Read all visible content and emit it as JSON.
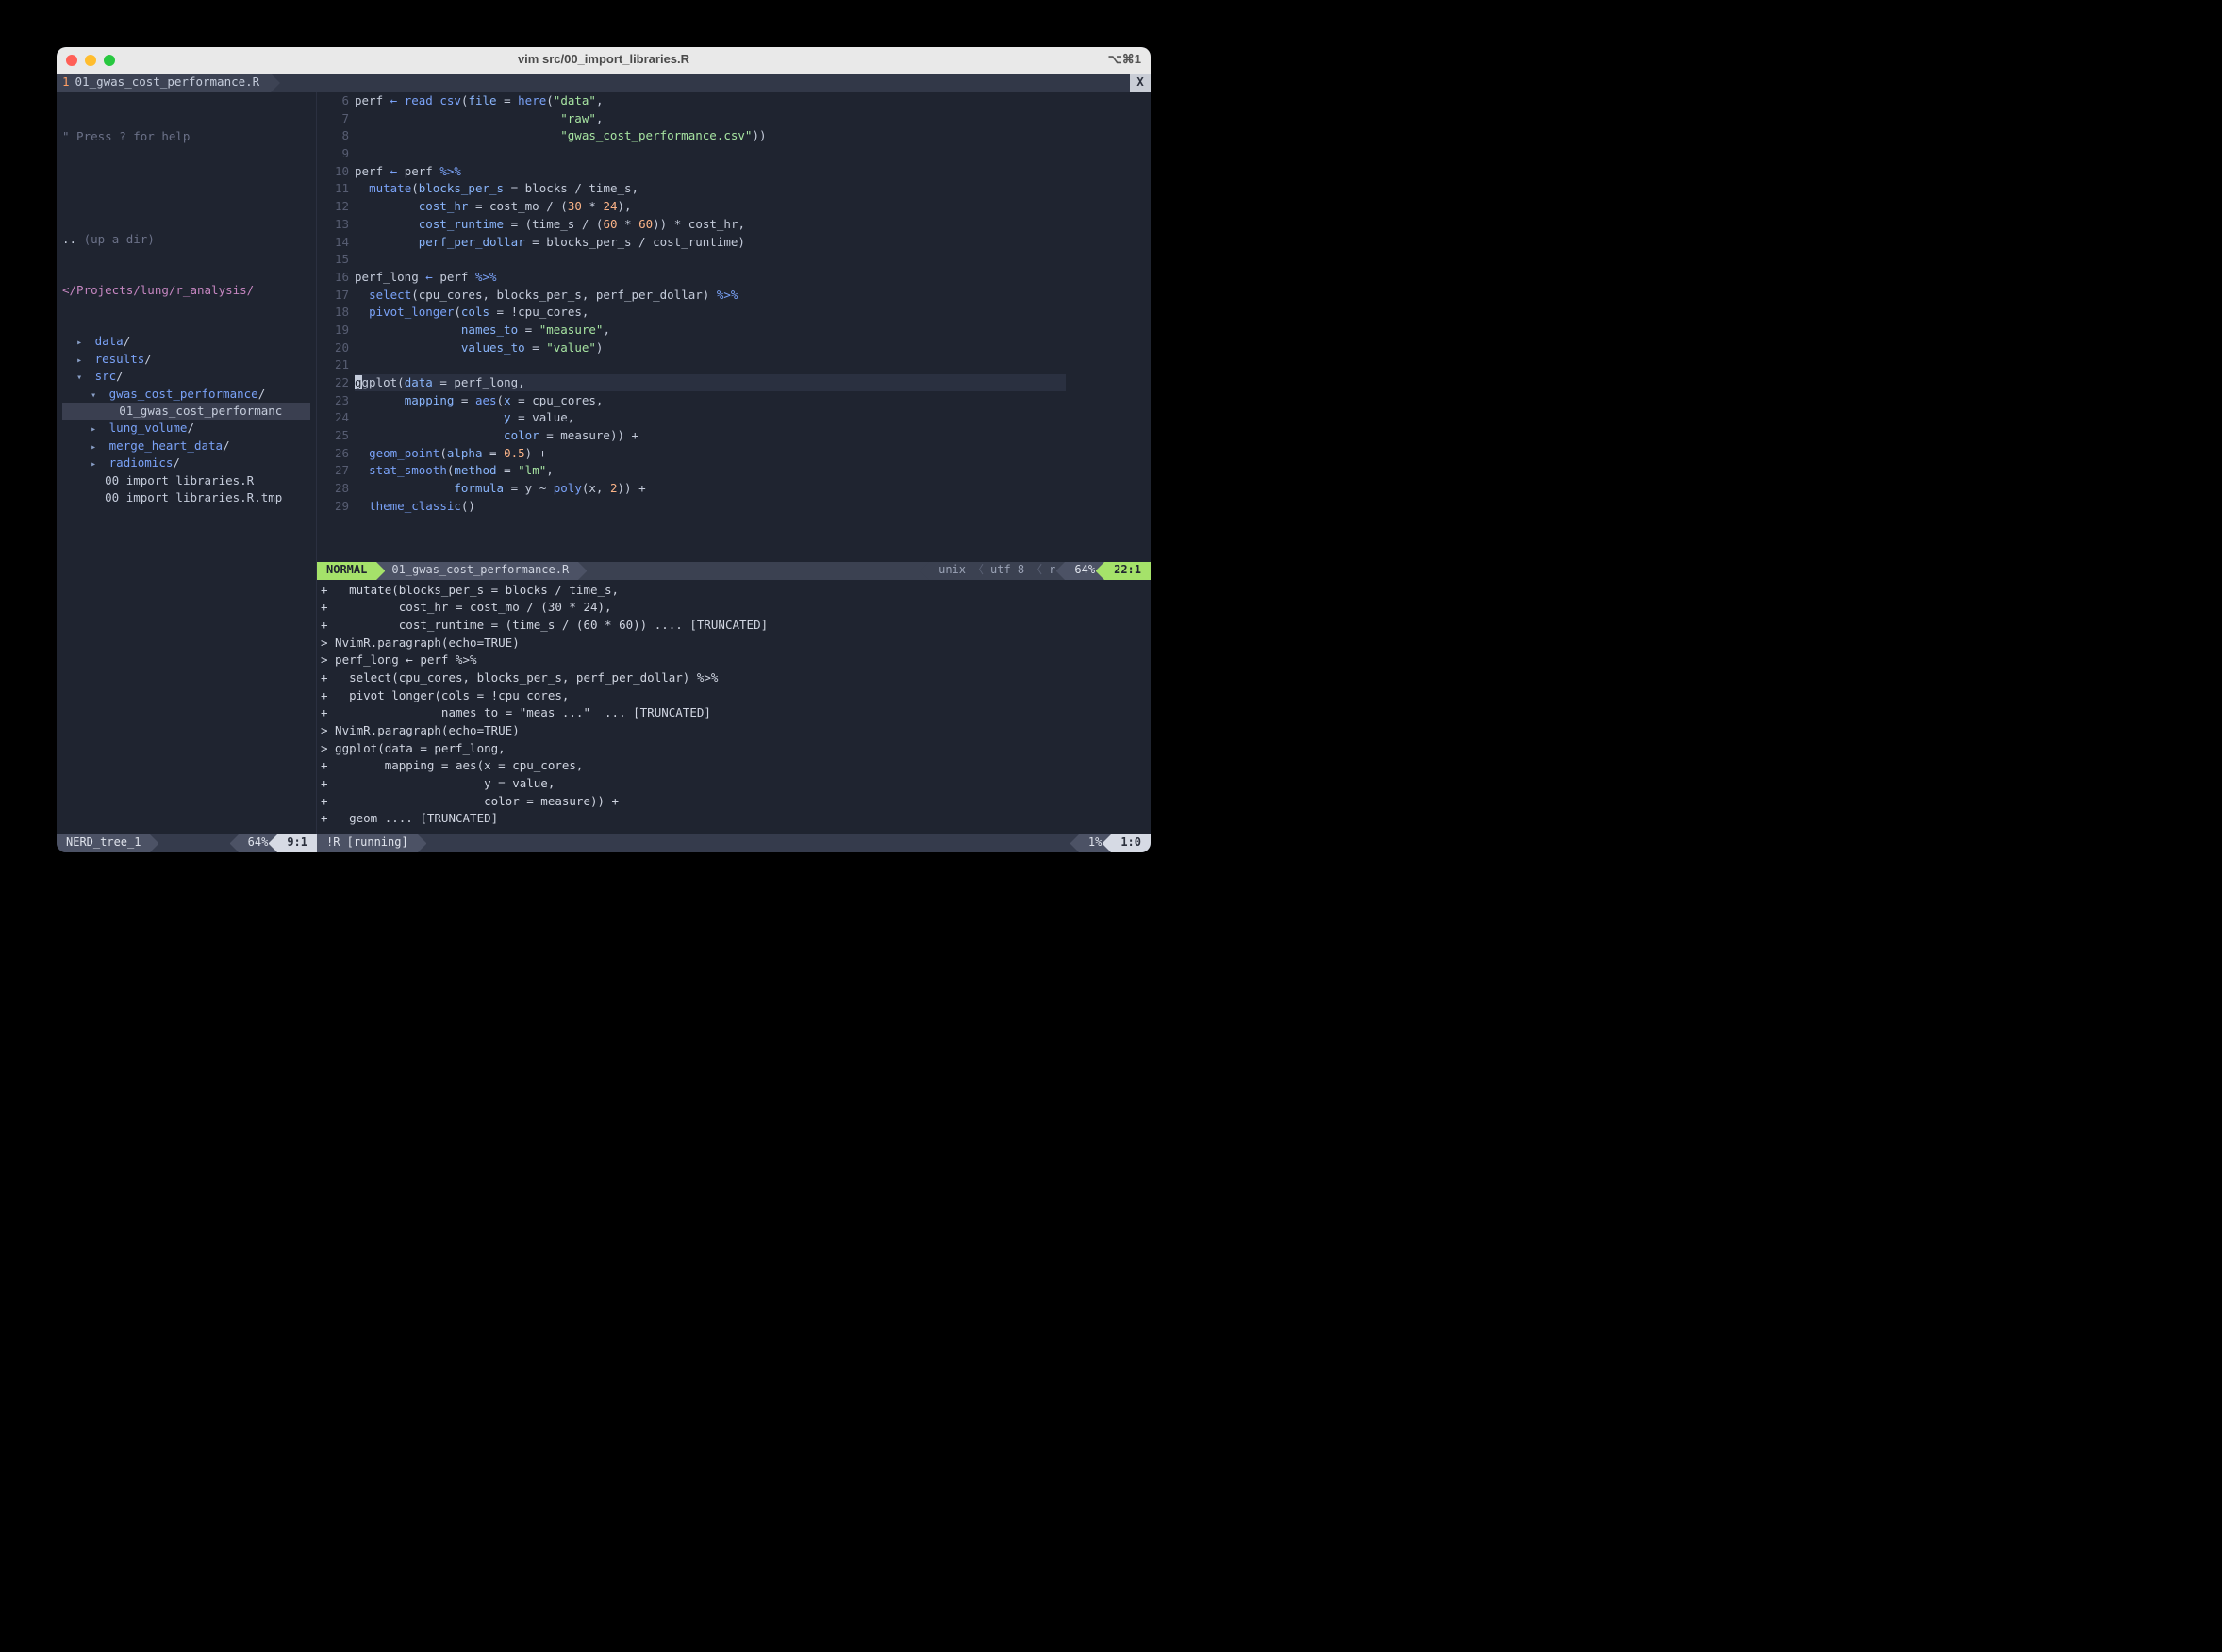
{
  "window": {
    "title": "vim src/00_import_libraries.R",
    "shortcut": "⌥⌘1"
  },
  "tabbar": {
    "tab_number": "1",
    "tab_label": "01_gwas_cost_performance.R",
    "close_label": "X"
  },
  "nerdtree": {
    "help": "\" Press ? for help",
    "updir_dots": "..",
    "updir_label": "(up a dir)",
    "root_path": "</Projects/lung/r_analysis/",
    "items": [
      {
        "indent": 1,
        "arrow": "▸",
        "type": "dir",
        "label": "data/"
      },
      {
        "indent": 1,
        "arrow": "▸",
        "type": "dir",
        "label": "results/"
      },
      {
        "indent": 1,
        "arrow": "▾",
        "type": "dir",
        "label": "src/"
      },
      {
        "indent": 2,
        "arrow": "▾",
        "type": "dir",
        "label": "gwas_cost_performance/"
      },
      {
        "indent": 3,
        "arrow": "",
        "type": "file",
        "label": "01_gwas_cost_performanc",
        "sel": true
      },
      {
        "indent": 2,
        "arrow": "▸",
        "type": "dir",
        "label": "lung_volume/"
      },
      {
        "indent": 2,
        "arrow": "▸",
        "type": "dir",
        "label": "merge_heart_data/"
      },
      {
        "indent": 2,
        "arrow": "▸",
        "type": "dir",
        "label": "radiomics/"
      },
      {
        "indent": 2,
        "arrow": "",
        "type": "file",
        "label": "00_import_libraries.R"
      },
      {
        "indent": 2,
        "arrow": "",
        "type": "file",
        "label": "00_import_libraries.R.tmp"
      }
    ]
  },
  "editor": {
    "lines": [
      {
        "n": 6,
        "html": "perf <span class='pipe'>←</span> <span class='fn'>read_csv</span>(<span class='arg'>file</span> <span class='op'>=</span> <span class='fn'>here</span>(<span class='str'>\"data\"</span>,"
      },
      {
        "n": 7,
        "html": "                             <span class='str'>\"raw\"</span>,"
      },
      {
        "n": 8,
        "html": "                             <span class='str'>\"gwas_cost_performance.csv\"</span>))"
      },
      {
        "n": 9,
        "html": ""
      },
      {
        "n": 10,
        "html": "perf <span class='pipe'>←</span> perf <span class='pipe'>%&gt;%</span>"
      },
      {
        "n": 11,
        "html": "  <span class='fn'>mutate</span>(<span class='arg'>blocks_per_s</span> <span class='op'>=</span> blocks <span class='op'>/</span> time_s,"
      },
      {
        "n": 12,
        "html": "         <span class='arg'>cost_hr</span> <span class='op'>=</span> cost_mo <span class='op'>/</span> (<span class='num'>30</span> <span class='op'>*</span> <span class='num'>24</span>),"
      },
      {
        "n": 13,
        "html": "         <span class='arg'>cost_runtime</span> <span class='op'>=</span> (time_s <span class='op'>/</span> (<span class='num'>60</span> <span class='op'>*</span> <span class='num'>60</span>)) <span class='op'>*</span> cost_hr,"
      },
      {
        "n": 14,
        "html": "         <span class='arg'>perf_per_dollar</span> <span class='op'>=</span> blocks_per_s <span class='op'>/</span> cost_runtime)"
      },
      {
        "n": 15,
        "html": ""
      },
      {
        "n": 16,
        "html": "perf_long <span class='pipe'>←</span> perf <span class='pipe'>%&gt;%</span>"
      },
      {
        "n": 17,
        "html": "  <span class='fn'>select</span>(cpu_cores, blocks_per_s, perf_per_dollar) <span class='pipe'>%&gt;%</span>"
      },
      {
        "n": 18,
        "html": "  <span class='fn'>pivot_longer</span>(<span class='arg'>cols</span> <span class='op'>=</span> <span class='op'>!</span>cpu_cores,"
      },
      {
        "n": 19,
        "html": "               <span class='arg'>names_to</span> <span class='op'>=</span> <span class='str'>\"measure\"</span>,"
      },
      {
        "n": 20,
        "html": "               <span class='arg'>values_to</span> <span class='op'>=</span> <span class='str'>\"value\"</span>)"
      },
      {
        "n": 21,
        "html": ""
      },
      {
        "n": 22,
        "html": "<span class='cursor-block'>g</span>gplot(<span class='arg'>data</span> <span class='op'>=</span> perf_long,",
        "current": true
      },
      {
        "n": 23,
        "html": "       <span class='arg'>mapping</span> <span class='op'>=</span> <span class='fn'>aes</span>(<span class='arg'>x</span> <span class='op'>=</span> cpu_cores,"
      },
      {
        "n": 24,
        "html": "                     <span class='arg'>y</span> <span class='op'>=</span> value,"
      },
      {
        "n": 25,
        "html": "                     <span class='arg'>color</span> <span class='op'>=</span> measure)) <span class='op'>+</span>"
      },
      {
        "n": 26,
        "html": "  <span class='fn'>geom_point</span>(<span class='arg'>alpha</span> <span class='op'>=</span> <span class='num'>0.5</span>) <span class='op'>+</span>"
      },
      {
        "n": 27,
        "html": "  <span class='fn'>stat_smooth</span>(<span class='arg'>method</span> <span class='op'>=</span> <span class='str'>\"lm\"</span>,"
      },
      {
        "n": 28,
        "html": "              <span class='arg'>formula</span> <span class='op'>=</span> y <span class='op'>~</span> <span class='fn'>poly</span>(x, <span class='num'>2</span>)) <span class='op'>+</span>"
      },
      {
        "n": 29,
        "html": "  <span class='fn'>theme_classic</span>()"
      }
    ]
  },
  "statusline": {
    "mode": "NORMAL",
    "file": "01_gwas_cost_performance.R",
    "fileformat": "unix",
    "encoding": "utf-8",
    "filetype": "r",
    "percent": "64%",
    "position": "22:1"
  },
  "repl": {
    "lines": [
      "+   mutate(blocks_per_s = blocks / time_s,",
      "+          cost_hr = cost_mo / (30 * 24),",
      "+          cost_runtime = (time_s / (60 * 60)) .... [TRUNCATED]",
      "> NvimR.paragraph(echo=TRUE)",
      "> perf_long ← perf %>%",
      "+   select(cpu_cores, blocks_per_s, perf_per_dollar) %>%",
      "+   pivot_longer(cols = !cpu_cores,",
      "+                names_to = \"meas ...\"  ... [TRUNCATED]",
      "> NvimR.paragraph(echo=TRUE)",
      "> ggplot(data = perf_long,",
      "+        mapping = aes(x = cpu_cores,",
      "+                      y = value,",
      "+                      color = measure)) +",
      "+   geom .... [TRUNCATED]",
      ">"
    ]
  },
  "bottom": {
    "nerd_name": "NERD_tree_1",
    "nerd_pct": "64%",
    "nerd_pos": "9:1",
    "repl_name": "!R [running]",
    "repl_pct": "1%",
    "repl_pos": "1:0"
  }
}
